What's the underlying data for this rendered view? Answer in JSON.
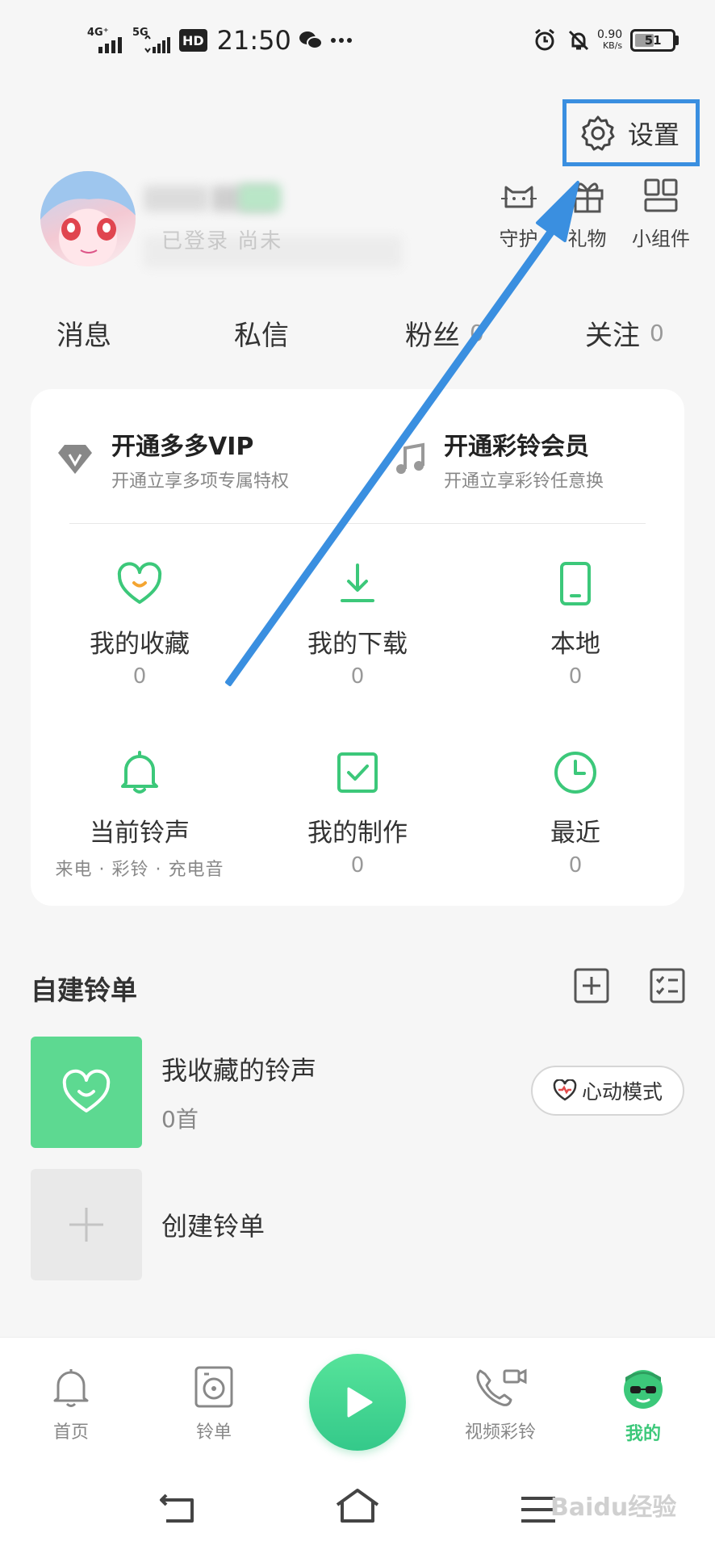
{
  "status_bar": {
    "time": "21:50",
    "network_1": "4G⁺",
    "network_2": "5G",
    "hd": "HD",
    "speed_value": "0.90",
    "speed_unit": "KB/s",
    "battery": "51",
    "battery_level": 0.51
  },
  "header": {
    "settings_label": "设置"
  },
  "profile": {
    "status_text": "已登录   尚未"
  },
  "quick_actions": [
    {
      "label": "守护",
      "icon": "cat-icon"
    },
    {
      "label": "礼物",
      "icon": "gift-icon"
    },
    {
      "label": "小组件",
      "icon": "widget-icon"
    }
  ],
  "stats": [
    {
      "label": "消息",
      "value": ""
    },
    {
      "label": "私信",
      "value": ""
    },
    {
      "label": "粉丝",
      "value": "0"
    },
    {
      "label": "关注",
      "value": "0"
    }
  ],
  "vip": [
    {
      "title": "开通多多VIP",
      "subtitle": "开通立享多项专属特权",
      "icon": "diamond-icon"
    },
    {
      "title": "开通彩铃会员",
      "subtitle": "开通立享彩铃任意换",
      "icon": "music-note-icon"
    }
  ],
  "grid": [
    {
      "label": "我的收藏",
      "count": "0",
      "icon": "heart-icon"
    },
    {
      "label": "我的下载",
      "count": "0",
      "icon": "download-icon"
    },
    {
      "label": "本地",
      "count": "0",
      "icon": "phone-icon"
    },
    {
      "label": "当前铃声",
      "sub": "来电 · 彩铃 · 充电音",
      "icon": "bell-icon"
    },
    {
      "label": "我的制作",
      "count": "0",
      "icon": "check-box-icon"
    },
    {
      "label": "最近",
      "count": "0",
      "icon": "clock-icon"
    }
  ],
  "playlists": {
    "section_title": "自建铃单",
    "items": [
      {
        "title": "我收藏的铃声",
        "count": "0首"
      },
      {
        "title": "创建铃单"
      }
    ],
    "heart_mode_label": "心动模式"
  },
  "bottom_nav": [
    {
      "label": "首页",
      "icon": "bell-outline-icon",
      "active": false
    },
    {
      "label": "铃单",
      "icon": "disc-icon",
      "active": false
    },
    {
      "label": "",
      "icon": "play-icon",
      "active": false
    },
    {
      "label": "视频彩铃",
      "icon": "video-call-icon",
      "active": false
    },
    {
      "label": "我的",
      "icon": "avatar-icon",
      "active": true
    }
  ],
  "watermark": "Baidu经验",
  "colors": {
    "accent": "#3cc87a",
    "highlight_box": "#3a8fe0",
    "arrow": "#3a8fe0"
  }
}
